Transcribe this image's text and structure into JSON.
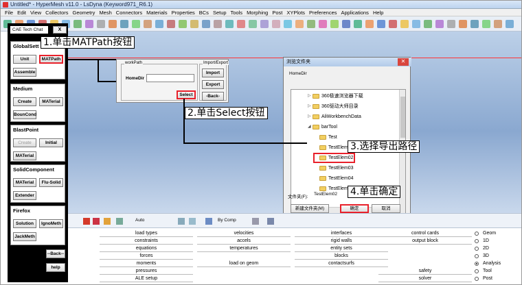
{
  "window": {
    "title": "Untitled* - HyperMesh v11.0 - LsDyna  (Keyword971_R6.1)"
  },
  "menu": [
    "File",
    "Edit",
    "View",
    "Collectors",
    "Geometry",
    "Mesh",
    "Connectors",
    "Materials",
    "Properties",
    "BCs",
    "Setup",
    "Tools",
    "Morphing",
    "Post",
    "XYPlots",
    "Preferences",
    "Applications",
    "Help"
  ],
  "left_panel": {
    "title": "CAE Tech Chat",
    "close": "X",
    "groups": [
      {
        "header": "GlobalSett",
        "buttons": [
          {
            "label": "Unit"
          },
          {
            "label": "MATPath"
          },
          {
            "label": "Assemble"
          }
        ]
      },
      {
        "header": "Medium",
        "buttons": [
          {
            "label": "Create"
          },
          {
            "label": "MATerial"
          },
          {
            "label": "BounCond"
          }
        ]
      },
      {
        "header": "BlastPoint",
        "buttons": [
          {
            "label": "Create"
          },
          {
            "label": "Initial"
          },
          {
            "label": "MATerial"
          }
        ]
      },
      {
        "header": "SolidComponent",
        "buttons": [
          {
            "label": "MATerial"
          },
          {
            "label": "Flu-Solid"
          },
          {
            "label": "Extender"
          }
        ]
      },
      {
        "header": "Firefox",
        "buttons": [
          {
            "label": "Solution"
          },
          {
            "label": "IgnoMeth"
          },
          {
            "label": "JackMeth"
          }
        ]
      }
    ],
    "back": "--Back--",
    "help": "help"
  },
  "workpath_dialog": {
    "workpath_legend": "workPath",
    "homedir_label": "HomeDir",
    "select": "Select",
    "io_legend": "Import/Export",
    "import": "Import",
    "export": "Export",
    "back": "-Back-"
  },
  "browse_dialog": {
    "title": "浏览文件夹",
    "close": "✕",
    "subtitle": "HomeDir",
    "tree": [
      {
        "label": "360极速浏览器下载",
        "level": 1,
        "arrow": "▷"
      },
      {
        "label": "360驱动大师目录",
        "level": 1,
        "arrow": "▷"
      },
      {
        "label": "AliWorkbenchData",
        "level": 1,
        "arrow": "▷"
      },
      {
        "label": "barTool",
        "level": 1,
        "arrow": "◢"
      },
      {
        "label": "Test",
        "level": 2,
        "arrow": ""
      },
      {
        "label": "TestElem",
        "level": 2,
        "arrow": ""
      },
      {
        "label": "TestElem02",
        "level": 2,
        "arrow": ""
      },
      {
        "label": "TestElem03",
        "level": 2,
        "arrow": ""
      },
      {
        "label": "TestElem04",
        "level": 2,
        "arrow": ""
      },
      {
        "label": "TestElem05",
        "level": 2,
        "arrow": ""
      }
    ],
    "folder_label": "文件夹(F):",
    "folder_value": "TestElem02",
    "new_folder": "新建文件夹(M)",
    "ok": "确定",
    "cancel": "取消"
  },
  "annotations": {
    "step1": "1.单击MATPath按钮",
    "step2": "2.单击Select按钮",
    "step3": "3.选择导出路径",
    "step4": "4.单击确定"
  },
  "tool2": {
    "auto": "Auto",
    "by_comp": "By Comp"
  },
  "bottom": {
    "col1": [
      "load types",
      "constraints",
      "equations",
      "forces",
      "moments",
      "pressures",
      "ALE setup"
    ],
    "col2": [
      "velocities",
      "accels",
      "temperatures",
      "",
      "load on geom"
    ],
    "col3": [
      "interfaces",
      "rigid walls",
      "entity sets",
      "blocks",
      "contactsurfs"
    ],
    "col4": [
      "control cards",
      "output block",
      "",
      "",
      "",
      "safety",
      "solver"
    ],
    "radios": [
      {
        "label": "Geom",
        "on": false
      },
      {
        "label": "1D",
        "on": false
      },
      {
        "label": "2D",
        "on": false
      },
      {
        "label": "3D",
        "on": false
      },
      {
        "label": "Analysis",
        "on": true
      },
      {
        "label": "Tool",
        "on": false
      },
      {
        "label": "Post",
        "on": false
      }
    ]
  },
  "colors": {
    "highlight": "#e8202a",
    "folder": "#f2cf61",
    "panel": "#000000"
  }
}
